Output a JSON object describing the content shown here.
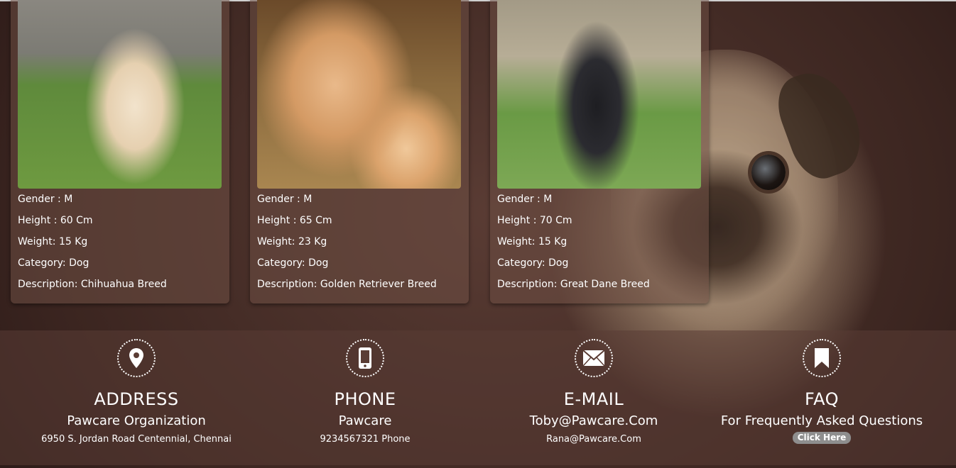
{
  "cards": [
    {
      "gender": "Gender : M",
      "height": "Height : 60 Cm",
      "weight": "Weight: 15 Kg",
      "category": "Category: Dog",
      "description": "Description: Chihuahua Breed"
    },
    {
      "gender": "Gender : M",
      "height": "Height : 65 Cm",
      "weight": "Weight: 23 Kg",
      "category": "Category: Dog",
      "description": "Description: Golden Retriever Breed"
    },
    {
      "gender": "Gender : M",
      "height": "Height : 70 Cm",
      "weight": "Weight: 15 Kg",
      "category": "Category: Dog",
      "description": "Description: Great Dane Breed"
    }
  ],
  "footer": {
    "address": {
      "icon": "location-pin-icon",
      "title": "ADDRESS",
      "name": "Pawcare Organization",
      "detail": "6950 S. Jordan Road Centennial, Chennai"
    },
    "phone": {
      "icon": "mobile-phone-icon",
      "title": "PHONE",
      "name": "Pawcare",
      "detail": "9234567321 Phone"
    },
    "email": {
      "icon": "envelope-icon",
      "title": "E-MAIL",
      "name": "Toby@Pawcare.Com",
      "detail": "Rana@Pawcare.Com"
    },
    "faq": {
      "icon": "bookmark-icon",
      "title": "FAQ",
      "name": "For Frequently Asked Questions",
      "button": "Click Here"
    }
  },
  "colors": {
    "card_bg": "#6e4e44",
    "footer_bg": "#5a3c34",
    "button_bg": "#8e8e8e"
  }
}
